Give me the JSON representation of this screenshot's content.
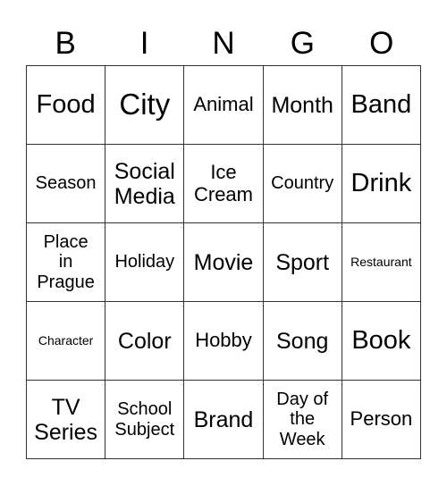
{
  "header": {
    "letters": [
      "B",
      "I",
      "N",
      "G",
      "O"
    ]
  },
  "cells": [
    [
      "Food",
      "City",
      "Animal",
      "Month",
      "Band"
    ],
    [
      "Season",
      "Social\nMedia",
      "Ice\nCream",
      "Country",
      "Drink"
    ],
    [
      "Place\nin\nPrague",
      "Holiday",
      "Movie",
      "Sport",
      "Restaurant"
    ],
    [
      "Character",
      "Color",
      "Hobby",
      "Song",
      "Book"
    ],
    [
      "TV\nSeries",
      "School\nSubject",
      "Brand",
      "Day of\nthe\nWeek",
      "Person"
    ]
  ]
}
